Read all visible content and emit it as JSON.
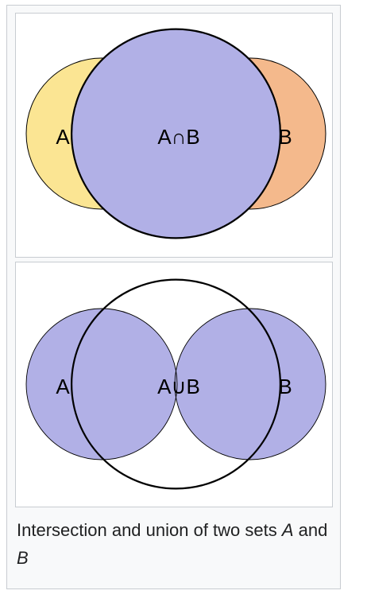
{
  "intersection_diagram": {
    "label_a": "A",
    "label_b": "B",
    "label_center": "A∩B",
    "colors": {
      "set_a_fill": "#fbe593",
      "set_b_fill": "#f4b98c",
      "intersection_fill": "#b1b0e6",
      "stroke": "#000000"
    }
  },
  "union_diagram": {
    "label_a": "A",
    "label_b": "B",
    "label_center": "A∪B",
    "colors": {
      "union_fill": "#b1b0e6",
      "stroke": "#000000"
    }
  },
  "caption": {
    "text_start": "Intersection and union of two sets ",
    "set_a": "A",
    "conjunction": " and ",
    "set_b": "B"
  }
}
